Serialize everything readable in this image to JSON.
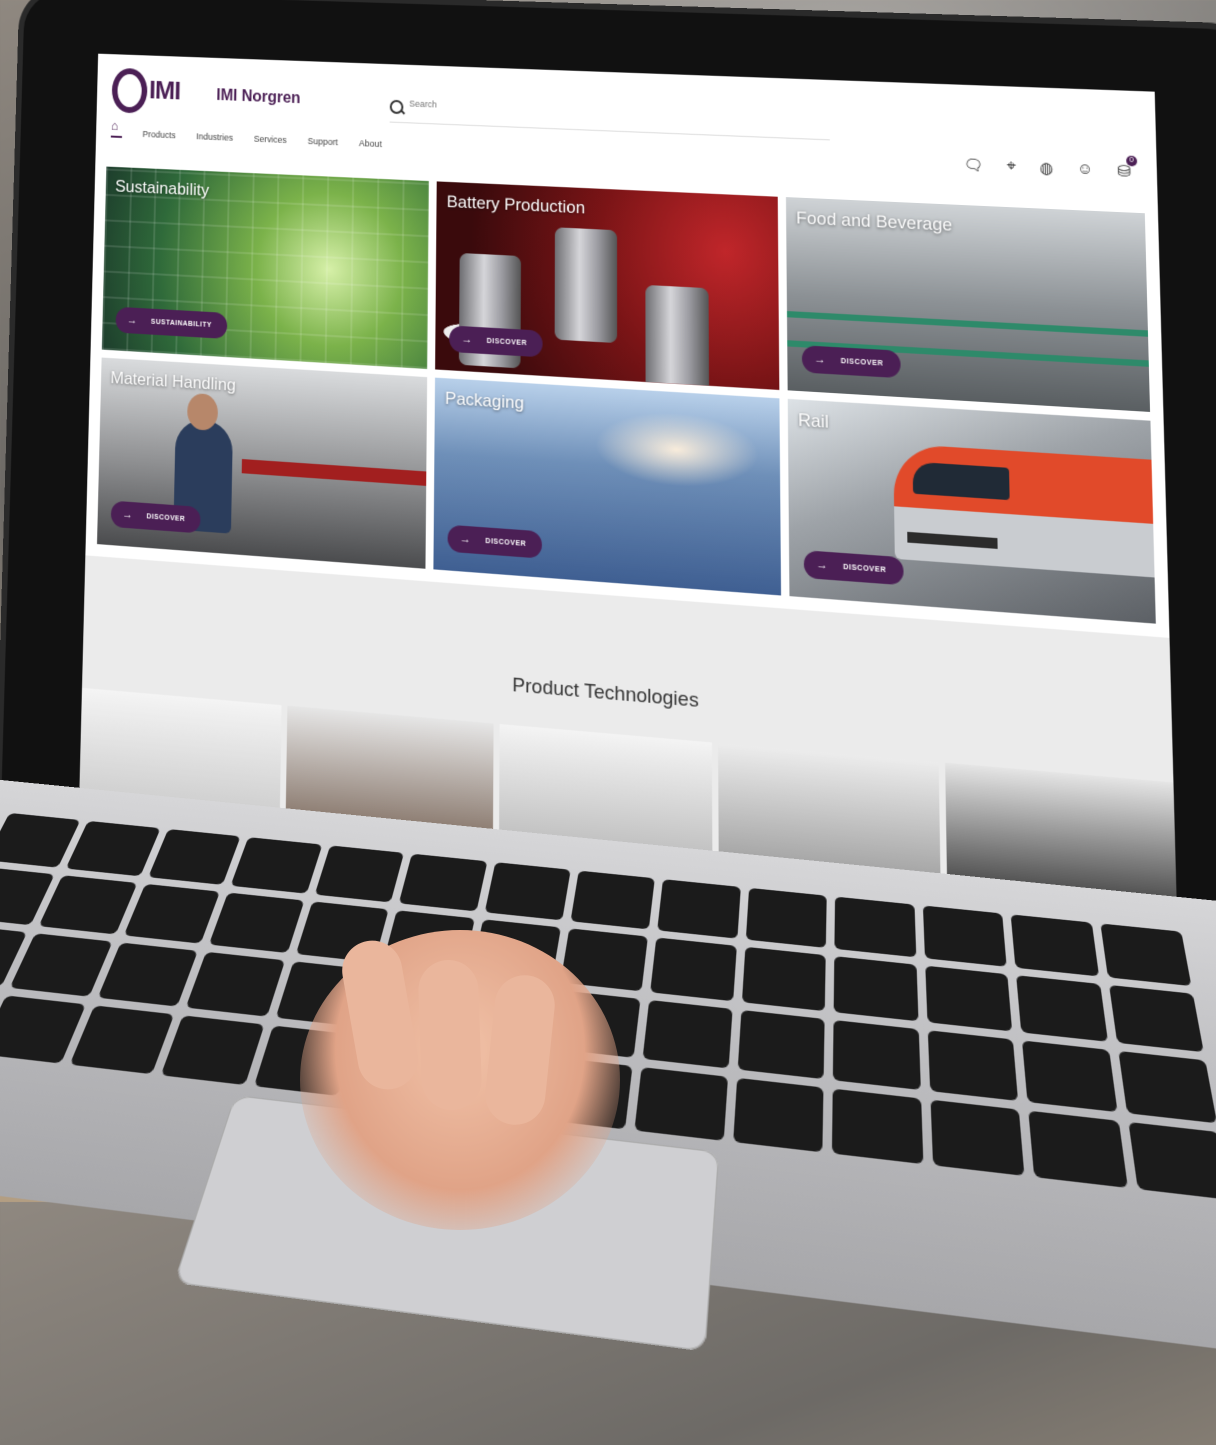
{
  "header": {
    "logo_text": "IMI",
    "brand_name": "IMI Norgren",
    "search_placeholder": "Search",
    "nav": [
      "Products",
      "Industries",
      "Services",
      "Support",
      "About"
    ],
    "cart_count": "0"
  },
  "tiles": [
    {
      "title": "Sustainability",
      "button": "SUSTAINABILITY"
    },
    {
      "title": "Battery Production",
      "button": "DISCOVER"
    },
    {
      "title": "Food and Beverage",
      "button": "DISCOVER"
    },
    {
      "title": "Material Handling",
      "button": "DISCOVER"
    },
    {
      "title": "Packaging",
      "button": "DISCOVER"
    },
    {
      "title": "Rail",
      "button": "DISCOVER"
    }
  ],
  "product_technologies": {
    "title": "Product Technologies"
  },
  "icons": [
    "home-icon",
    "search-icon",
    "chat-icon",
    "location-pin-icon",
    "globe-icon",
    "user-icon",
    "basket-icon",
    "arrow-right-icon"
  ],
  "colors": {
    "brand_purple": "#4b1f55"
  }
}
